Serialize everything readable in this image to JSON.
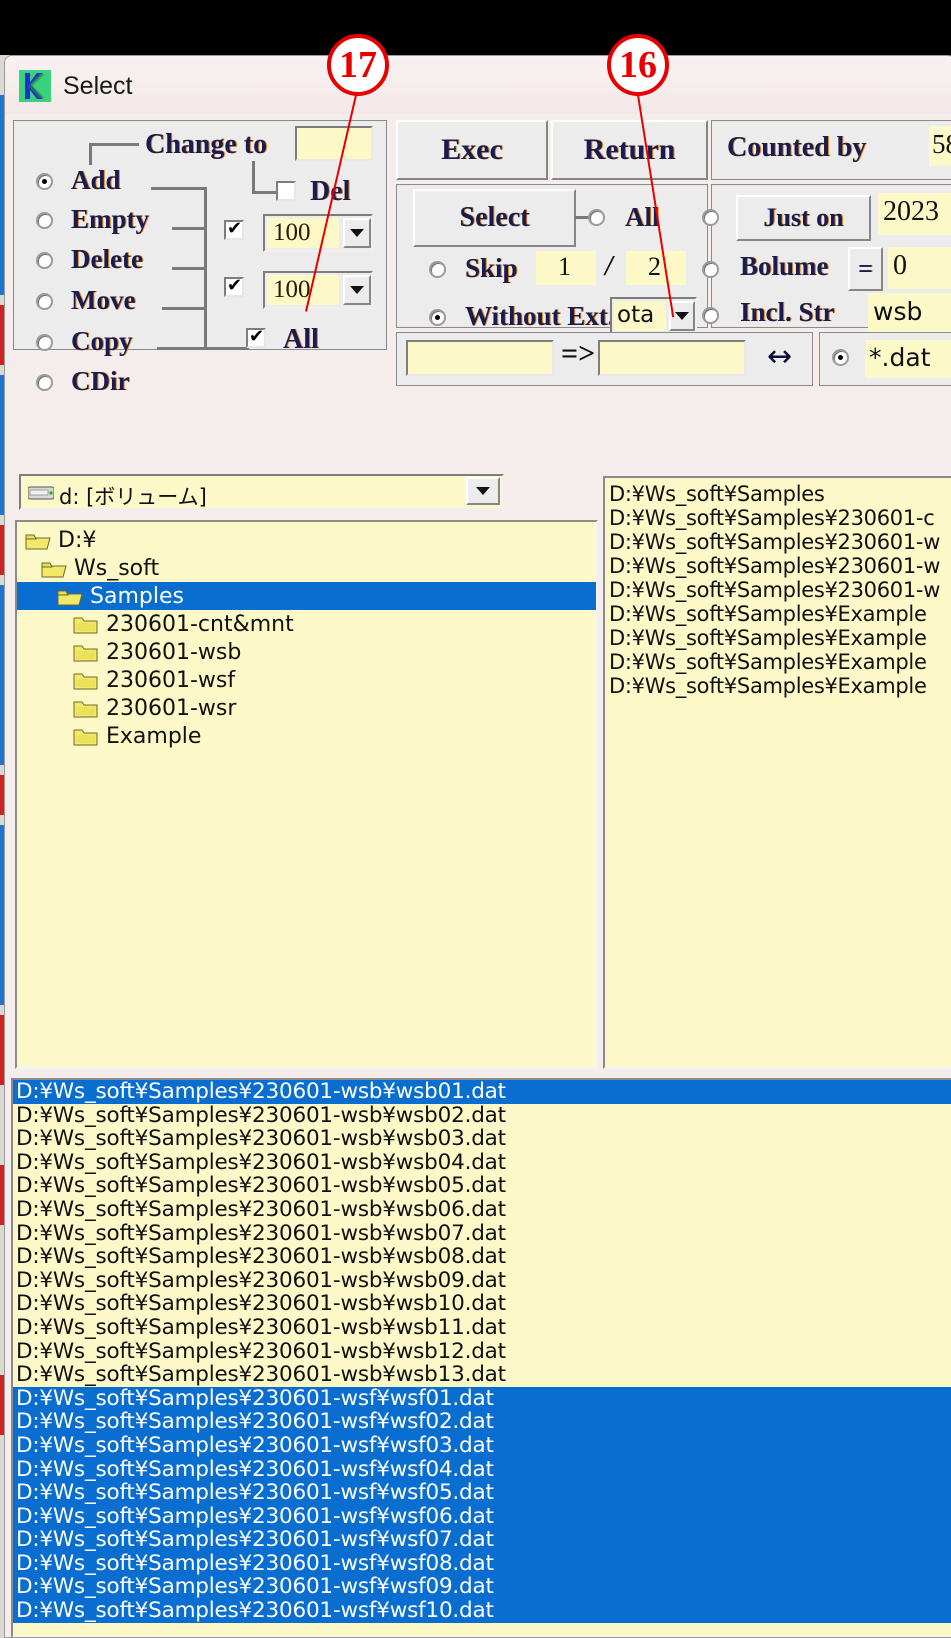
{
  "window": {
    "title": "Select",
    "icon": "app-k-icon"
  },
  "ops_panel": {
    "change_to_label": "Change to",
    "change_to_value": "",
    "del_label": "Del",
    "del_checked": false,
    "all_label": "All",
    "all_checked": true,
    "radios": [
      {
        "label": "Add",
        "checked": true
      },
      {
        "label": "Empty",
        "checked": false
      },
      {
        "label": "Delete",
        "checked": false
      },
      {
        "label": "Move",
        "checked": false
      },
      {
        "label": "Copy",
        "checked": false
      },
      {
        "label": "CDir",
        "checked": false
      }
    ],
    "spin1": {
      "checked": true,
      "value": "100"
    },
    "spin2": {
      "checked": true,
      "value": "100"
    }
  },
  "action_panel": {
    "exec_label": "Exec",
    "return_label": "Return",
    "select_label": "Select",
    "all_label": "All",
    "all_checked": false,
    "skip_label": "Skip",
    "skip_checked": false,
    "skip_num": "1",
    "skip_sep": "/",
    "skip_den": "2",
    "without_ext_label": "Without Ext.",
    "without_ext_checked": true,
    "without_ext_value": "ota",
    "rename_from": "",
    "rename_arrow": "=>",
    "rename_to": "",
    "swap_icon": "↔"
  },
  "filter_panel": {
    "counted_by_label": "Counted by",
    "counted_by_value": "58",
    "just_on_label": "Just on",
    "just_on_checked": false,
    "just_on_value": "2023",
    "bolume_label": "Bolume",
    "bolume_eq": "=",
    "bolume_checked": false,
    "bolume_value": "0",
    "incl_str_label": "Incl. Str",
    "incl_str_checked": false,
    "incl_str_value": "wsb",
    "mask_checked": true,
    "mask_value": "*.dat"
  },
  "drive": {
    "selected": "d: [ボリューム]",
    "icon": "drive-icon",
    "arrow_icon": "chevron-down-icon"
  },
  "tree": {
    "items": [
      {
        "label": "D:¥",
        "indent": 0,
        "selected": false,
        "open": true
      },
      {
        "label": "Ws_soft",
        "indent": 1,
        "selected": false,
        "open": true
      },
      {
        "label": "Samples",
        "indent": 2,
        "selected": true,
        "open": true
      },
      {
        "label": "230601-cnt&mnt",
        "indent": 3,
        "selected": false,
        "open": false
      },
      {
        "label": "230601-wsb",
        "indent": 3,
        "selected": false,
        "open": false
      },
      {
        "label": "230601-wsf",
        "indent": 3,
        "selected": false,
        "open": false
      },
      {
        "label": "230601-wsr",
        "indent": 3,
        "selected": false,
        "open": false
      },
      {
        "label": "Example",
        "indent": 3,
        "selected": false,
        "open": false
      }
    ]
  },
  "dir_list": {
    "rows": [
      "D:¥Ws_soft¥Samples",
      "D:¥Ws_soft¥Samples¥230601-c",
      "D:¥Ws_soft¥Samples¥230601-w",
      "D:¥Ws_soft¥Samples¥230601-w",
      "D:¥Ws_soft¥Samples¥230601-w",
      "D:¥Ws_soft¥Samples¥Example",
      "D:¥Ws_soft¥Samples¥Example",
      "D:¥Ws_soft¥Samples¥Example",
      "D:¥Ws_soft¥Samples¥Example"
    ]
  },
  "file_list": {
    "rows": [
      {
        "path": "D:¥Ws_soft¥Samples¥230601-wsb¥wsb01.dat",
        "selected": true
      },
      {
        "path": "D:¥Ws_soft¥Samples¥230601-wsb¥wsb02.dat",
        "selected": false
      },
      {
        "path": "D:¥Ws_soft¥Samples¥230601-wsb¥wsb03.dat",
        "selected": false
      },
      {
        "path": "D:¥Ws_soft¥Samples¥230601-wsb¥wsb04.dat",
        "selected": false
      },
      {
        "path": "D:¥Ws_soft¥Samples¥230601-wsb¥wsb05.dat",
        "selected": false
      },
      {
        "path": "D:¥Ws_soft¥Samples¥230601-wsb¥wsb06.dat",
        "selected": false
      },
      {
        "path": "D:¥Ws_soft¥Samples¥230601-wsb¥wsb07.dat",
        "selected": false
      },
      {
        "path": "D:¥Ws_soft¥Samples¥230601-wsb¥wsb08.dat",
        "selected": false
      },
      {
        "path": "D:¥Ws_soft¥Samples¥230601-wsb¥wsb09.dat",
        "selected": false
      },
      {
        "path": "D:¥Ws_soft¥Samples¥230601-wsb¥wsb10.dat",
        "selected": false
      },
      {
        "path": "D:¥Ws_soft¥Samples¥230601-wsb¥wsb11.dat",
        "selected": false
      },
      {
        "path": "D:¥Ws_soft¥Samples¥230601-wsb¥wsb12.dat",
        "selected": false
      },
      {
        "path": "D:¥Ws_soft¥Samples¥230601-wsb¥wsb13.dat",
        "selected": false
      },
      {
        "path": "D:¥Ws_soft¥Samples¥230601-wsf¥wsf01.dat",
        "selected": true
      },
      {
        "path": "D:¥Ws_soft¥Samples¥230601-wsf¥wsf02.dat",
        "selected": true
      },
      {
        "path": "D:¥Ws_soft¥Samples¥230601-wsf¥wsf03.dat",
        "selected": true
      },
      {
        "path": "D:¥Ws_soft¥Samples¥230601-wsf¥wsf04.dat",
        "selected": true
      },
      {
        "path": "D:¥Ws_soft¥Samples¥230601-wsf¥wsf05.dat",
        "selected": true
      },
      {
        "path": "D:¥Ws_soft¥Samples¥230601-wsf¥wsf06.dat",
        "selected": true
      },
      {
        "path": "D:¥Ws_soft¥Samples¥230601-wsf¥wsf07.dat",
        "selected": true
      },
      {
        "path": "D:¥Ws_soft¥Samples¥230601-wsf¥wsf08.dat",
        "selected": true
      },
      {
        "path": "D:¥Ws_soft¥Samples¥230601-wsf¥wsf09.dat",
        "selected": true
      },
      {
        "path": "D:¥Ws_soft¥Samples¥230601-wsf¥wsf10.dat",
        "selected": true
      }
    ]
  },
  "callouts": [
    {
      "number": "17",
      "color": "#e60000"
    },
    {
      "number": "16",
      "color": "#e60000"
    }
  ]
}
